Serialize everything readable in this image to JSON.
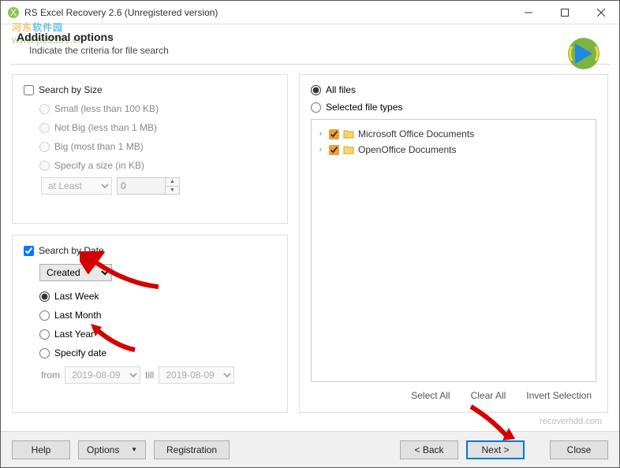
{
  "window": {
    "title": "RS Excel Recovery 2.6 (Unregistered version)"
  },
  "watermark": {
    "text_cn_1": "河东",
    "text_cn_2": "软件园",
    "url": "www.pc0359.cn"
  },
  "header": {
    "title": "Additional options",
    "subtitle": "Indicate the criteria for file search"
  },
  "size_panel": {
    "title": "Search by Size",
    "checked": false,
    "options": {
      "small": "Small (less than 100 KB)",
      "notbig": "Not Big (less than 1 MB)",
      "big": "Big (most than 1 MB)",
      "specify": "Specify a size (in KB)"
    },
    "spec": {
      "mode": "at Least",
      "value": "0"
    }
  },
  "date_panel": {
    "title": "Search by Date",
    "checked": true,
    "field": "Created",
    "options": {
      "last_week": "Last Week",
      "last_month": "Last Month",
      "last_year": "Last Year",
      "specify": "Specify date"
    },
    "selected": "last_week",
    "range": {
      "from_label": "from",
      "from": "2019-08-09",
      "till_label": "till",
      "till": "2019-08-09"
    }
  },
  "files_panel": {
    "all_label": "All files",
    "sel_label": "Selected file types",
    "mode": "all",
    "tree": [
      {
        "label": "Microsoft Office Documents",
        "checked": true
      },
      {
        "label": "OpenOffice Documents",
        "checked": true
      }
    ],
    "actions": {
      "select_all": "Select All",
      "clear_all": "Clear All",
      "invert": "Invert Selection"
    }
  },
  "footer": {
    "help": "Help",
    "options": "Options",
    "registration": "Registration",
    "back": "< Back",
    "next": "Next >",
    "close": "Close",
    "link": "recoverhdd.com"
  }
}
